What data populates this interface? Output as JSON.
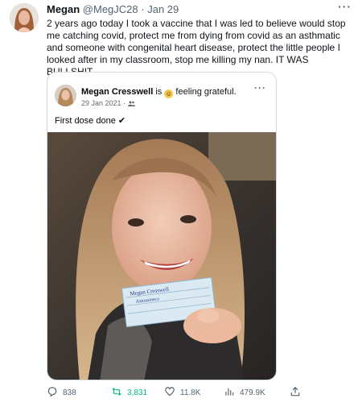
{
  "tweet": {
    "author_name": "Megan",
    "handle": "@MegJC28",
    "separator": "·",
    "time": "Jan 29",
    "more_label": "···",
    "text": "2 years ago today I took a vaccine that I was led to believe would stop me catching covid, protect me from dying from covid as an asthmatic and someone with congenital heart disease, protect the little people I looked after in my classroom, stop me killing my nan. IT WAS BULLSHIT"
  },
  "embed": {
    "name": "Megan Cresswell",
    "is_text": "is",
    "feeling": "feeling grateful.",
    "date": "29 Jan 2021",
    "date_sep": "·",
    "more_label": "···",
    "post_text": "First dose done ✔",
    "card_text": {
      "line1": "Megan Cresswell",
      "line2": "Astrazeneca"
    }
  },
  "actions": {
    "replies": "838",
    "retweets": "3,831",
    "likes": "11.8K",
    "views": "479.9K"
  },
  "colors": {
    "text": "#0f1419",
    "muted": "#536471",
    "retweet": "#00ba7c",
    "border": "#cfd9de"
  },
  "icons": [
    "reply-icon",
    "retweet-icon",
    "like-icon",
    "views-icon",
    "share-icon"
  ]
}
